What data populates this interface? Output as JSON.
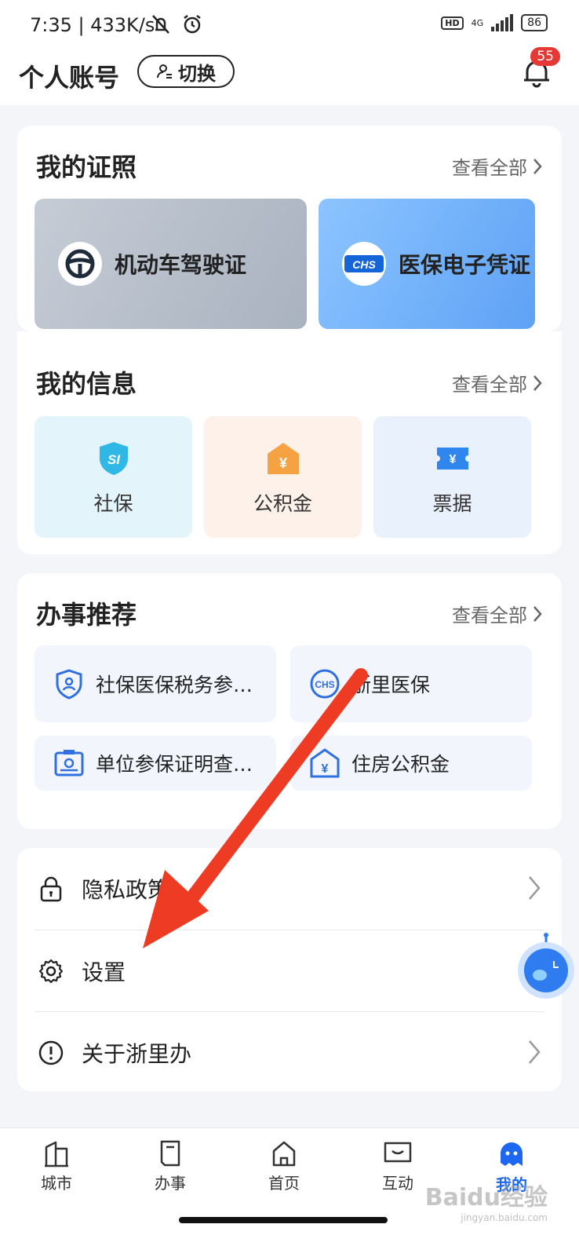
{
  "status_bar": {
    "time": "7:35 | 433K/s",
    "network": "4G",
    "battery": "86",
    "hd": "HD"
  },
  "header": {
    "title": "个人账号",
    "switch_label": "切换",
    "notification_count": "55"
  },
  "licenses": {
    "title": "我的证照",
    "see_all": "查看全部",
    "items": [
      {
        "label": "机动车驾驶证",
        "icon": "steering-wheel-icon"
      },
      {
        "label": "医保电子凭证",
        "icon": "chs-logo-icon",
        "logo_text": "CHS"
      }
    ]
  },
  "info": {
    "title": "我的信息",
    "see_all": "查看全部",
    "items": [
      {
        "label": "社保",
        "icon": "shield-si-icon",
        "icon_text": "SI",
        "bg": "#e3f5fa"
      },
      {
        "label": "公积金",
        "icon": "house-fund-icon",
        "icon_text": "¥",
        "bg": "#fdf1ea"
      },
      {
        "label": "票据",
        "icon": "ticket-icon",
        "icon_text": "¥",
        "bg": "#e9f1fd"
      }
    ]
  },
  "services": {
    "title": "办事推荐",
    "see_all": "查看全部",
    "items": [
      {
        "label": "社保医保税务参…",
        "icon": "person-shield-icon"
      },
      {
        "label": "浙里医保",
        "icon": "chs-circle-icon",
        "icon_text": "CHS"
      },
      {
        "label": "单位参保证明查…",
        "icon": "id-card-icon"
      },
      {
        "label": "住房公积金",
        "icon": "house-yen-icon",
        "icon_text": "¥"
      }
    ]
  },
  "settings": {
    "items": [
      {
        "label": "隐私政策",
        "icon": "lock-icon"
      },
      {
        "label": "设置",
        "icon": "gear-icon"
      },
      {
        "label": "关于浙里办",
        "icon": "info-circle-icon"
      }
    ]
  },
  "bottom_nav": {
    "items": [
      {
        "label": "城市",
        "icon": "city-icon"
      },
      {
        "label": "办事",
        "icon": "document-icon"
      },
      {
        "label": "首页",
        "icon": "home-icon"
      },
      {
        "label": "互动",
        "icon": "chat-icon"
      },
      {
        "label": "我的",
        "icon": "profile-icon",
        "active": true
      }
    ]
  },
  "watermark": {
    "text": "Baidu经验",
    "sub": "jingyan.baidu.com"
  },
  "colors": {
    "accent": "#1d67f2",
    "arrow": "#ee3b24",
    "badge": "#e53935"
  }
}
